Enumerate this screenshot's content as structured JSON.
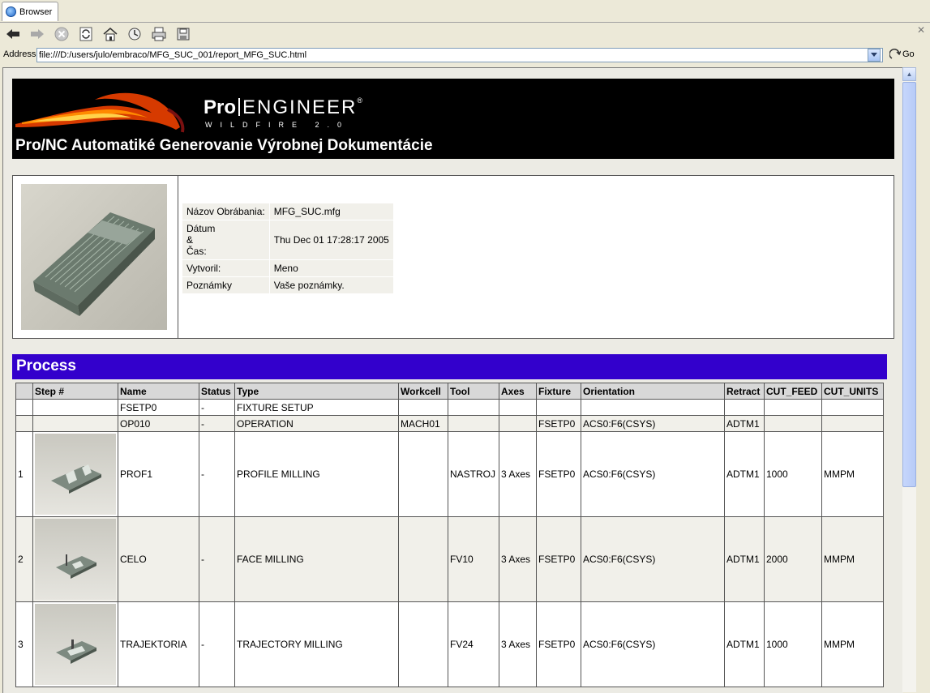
{
  "tab": {
    "label": "Browser"
  },
  "address": {
    "label": "Address",
    "value": "file:///D:/users/julo/embraco/MFG_SUC_001/report_MFG_SUC.html",
    "go": "Go"
  },
  "banner": {
    "logo_bold": "Pro",
    "logo_rest": "ENGINEER",
    "logo_sub": "WILDFIRE 2.0",
    "title": "Pro/NC Automatiké Generovanie Výrobnej Dokumentácie"
  },
  "info": {
    "rows": [
      {
        "label": "Názov Obrábania:",
        "value": "MFG_SUC.mfg"
      },
      {
        "label": "Dátum & Čas:",
        "label_lines": [
          "Dátum",
          "&",
          "Čas:"
        ],
        "value": "Thu Dec 01 17:28:17 2005"
      },
      {
        "label": "Vytvoril:",
        "value": "Meno"
      },
      {
        "label": "Poznámky",
        "value": "Vaše poznámky."
      }
    ]
  },
  "process": {
    "title": "Process",
    "headers": [
      "",
      "Step #",
      "Name",
      "Status",
      "Type",
      "Workcell",
      "Tool",
      "Axes",
      "Fixture",
      "Orientation",
      "Retract",
      "CUT_FEED",
      "CUT_UNITS"
    ],
    "rows": [
      {
        "num": "",
        "name": "FSETP0",
        "status": "-",
        "type": "FIXTURE SETUP",
        "workcell": "",
        "tool": "",
        "axes": "",
        "fixture": "",
        "orientation": "",
        "retract": "",
        "feed": "",
        "units": ""
      },
      {
        "num": "",
        "name": "OP010",
        "status": "-",
        "type": "OPERATION",
        "workcell": "MACH01",
        "tool": "",
        "axes": "",
        "fixture": "FSETP0",
        "orientation": "ACS0:F6(CSYS)",
        "retract": "ADTM1",
        "feed": "",
        "units": ""
      },
      {
        "num": "1",
        "name": "PROF1",
        "status": "-",
        "type": "PROFILE MILLING",
        "workcell": "",
        "tool": "NASTROJ",
        "axes": "3 Axes",
        "fixture": "FSETP0",
        "orientation": "ACS0:F6(CSYS)",
        "retract": "ADTM1",
        "feed": "1000",
        "units": "MMPM"
      },
      {
        "num": "2",
        "name": "CELO",
        "status": "-",
        "type": "FACE MILLING",
        "workcell": "",
        "tool": "FV10",
        "axes": "3 Axes",
        "fixture": "FSETP0",
        "orientation": "ACS0:F6(CSYS)",
        "retract": "ADTM1",
        "feed": "2000",
        "units": "MMPM"
      },
      {
        "num": "3",
        "name": "TRAJEKTORIA",
        "status": "-",
        "type": "TRAJECTORY MILLING",
        "workcell": "",
        "tool": "FV24",
        "axes": "3 Axes",
        "fixture": "FSETP0",
        "orientation": "ACS0:F6(CSYS)",
        "retract": "ADTM1",
        "feed": "1000",
        "units": "MMPM"
      }
    ]
  },
  "colors": {
    "process_header": "#3300cc",
    "banner_bg": "#000000"
  },
  "icons": [
    "back-icon",
    "forward-icon",
    "stop-icon",
    "refresh-icon",
    "home-icon",
    "history-icon",
    "print-icon",
    "save-icon",
    "close-icon",
    "go-icon",
    "dropdown-icon"
  ]
}
